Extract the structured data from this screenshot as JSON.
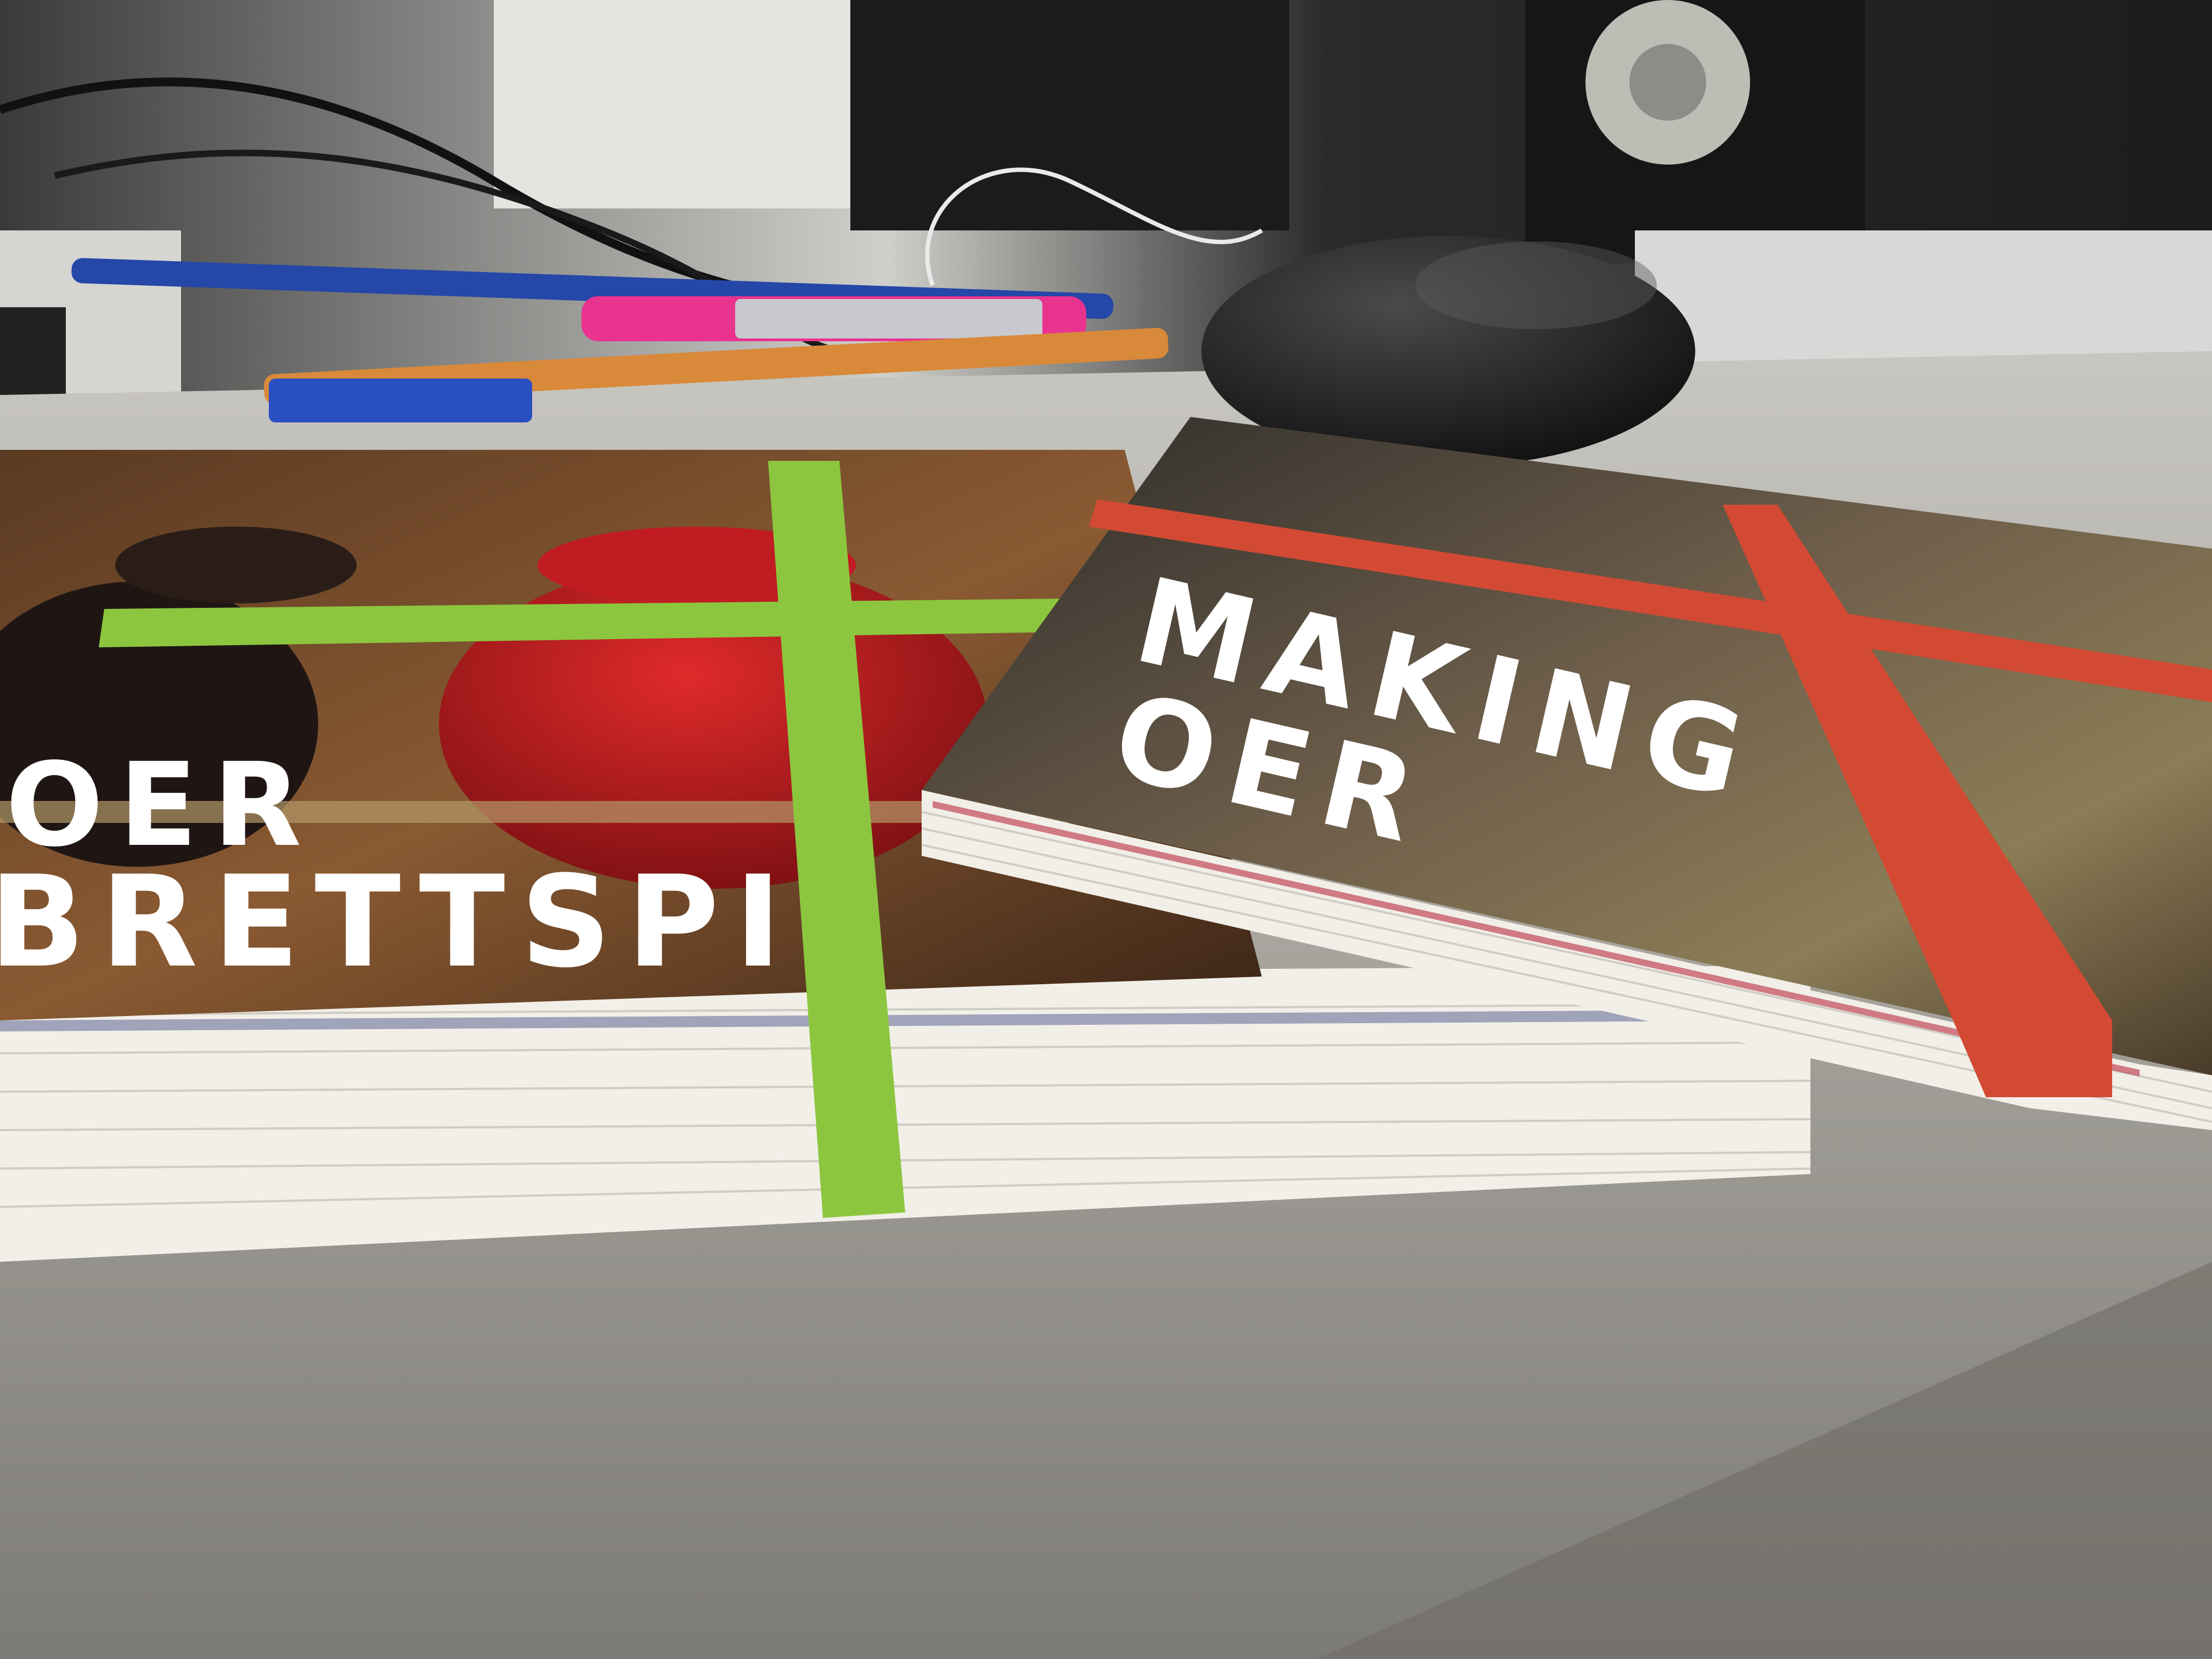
{
  "scene": {
    "description_colors": {
      "desk": "#a9a79f",
      "band_green": "#8cc63f",
      "band_red": "#d24a33",
      "pen_pink": "#e8338f",
      "pen_blue": "#2447a8",
      "pencil_orange": "#d9893a"
    }
  },
  "left_deck": {
    "title_line_1": "OER",
    "title_line_2": "BRETTSPI"
  },
  "right_deck": {
    "title_line_1": "MAKING",
    "title_line_2": "OER"
  }
}
